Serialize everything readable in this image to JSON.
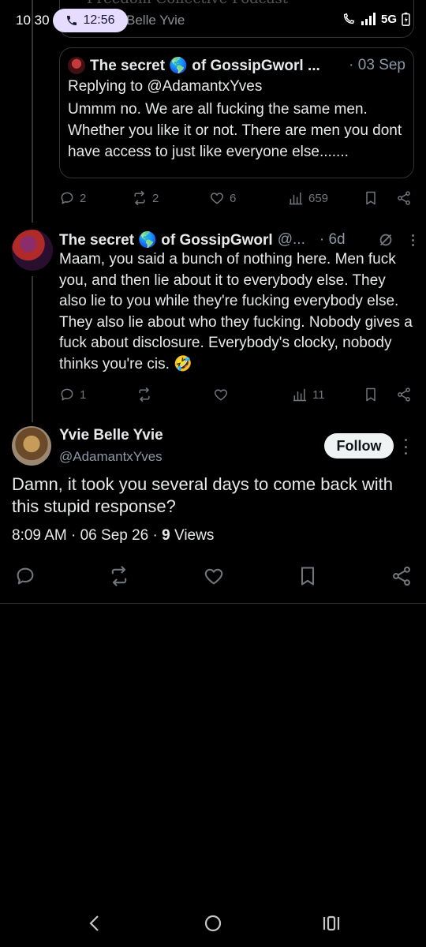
{
  "status_bar": {
    "time": "10:30",
    "call_timer": "12:56",
    "network": "5G",
    "behind_text": "Belle Yvie",
    "behind_title": "Freedom Collective Podcast"
  },
  "quoted_tweet": {
    "author": "The secret 🌎 of GossipGworl ...",
    "date": "· 03 Sep",
    "replying_to": "Replying to @AdamantxYves",
    "text": "Ummm no. We are all fucking the same men. Whether you like it or not.  There are men you dont have access to just like everyone else.......",
    "stats": {
      "replies": "2",
      "reposts": "2",
      "likes": "6",
      "views": "659"
    }
  },
  "reply_tweet": {
    "author": "The secret 🌎 of GossipGworl",
    "handle": "@...",
    "time": "· 6d",
    "text": "Maam, you said a bunch of nothing here. Men fuck you, and then lie about it to everybody else. They also lie to you while they're fucking everybody else. They also lie about who they fucking. Nobody gives a fuck about disclosure. Everybody's clocky, nobody thinks you're cis. 🤣",
    "stats": {
      "replies": "1",
      "views": "11"
    }
  },
  "main_tweet": {
    "author": "Yvie Belle Yvie",
    "handle": "@AdamantxYves",
    "follow_label": "Follow",
    "text": "Damn, it took you several days to come back with this stupid response?",
    "time": "8:09 AM",
    "date": "06 Sep 26",
    "views_count": "9",
    "views_label": "Views"
  },
  "colors": {
    "background": "#000000",
    "muted": "#71767b",
    "border": "#2f3336",
    "call_pill": "#e5dcff"
  }
}
